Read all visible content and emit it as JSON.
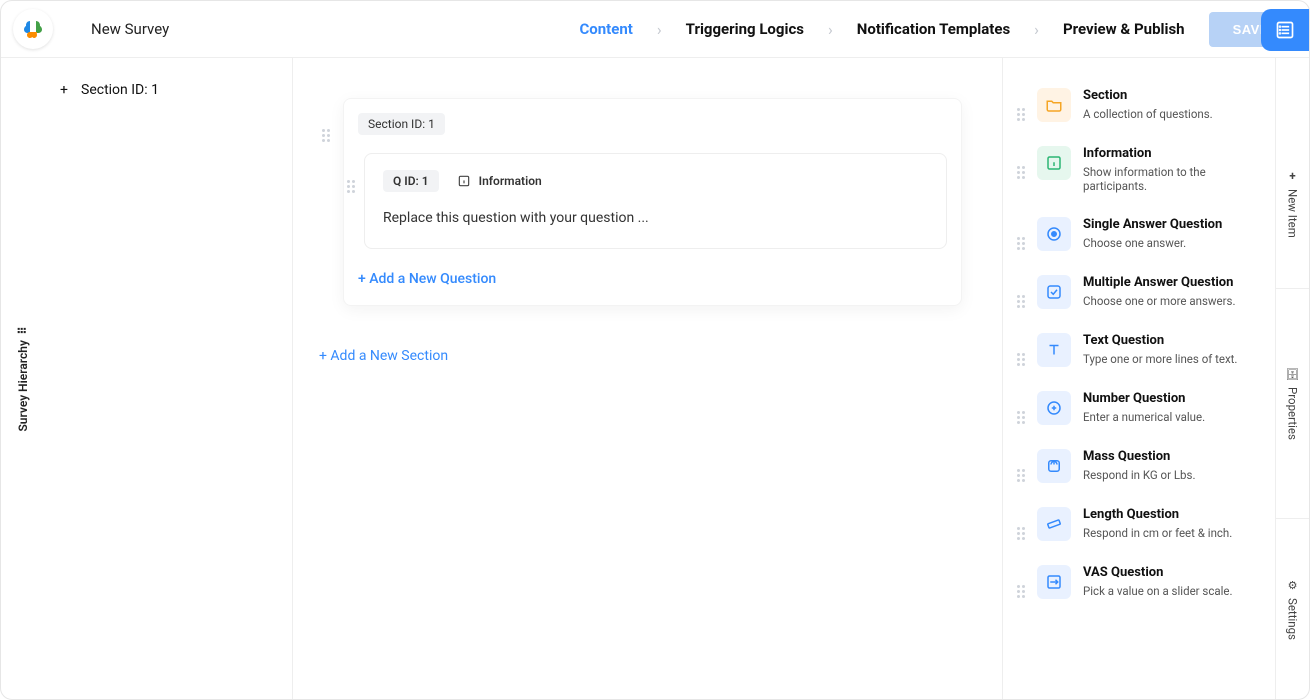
{
  "header": {
    "title": "New Survey",
    "breadcrumbs": [
      "Content",
      "Triggering Logics",
      "Notification Templates",
      "Preview & Publish"
    ],
    "active_breadcrumb": 0,
    "save_label": "SAVE"
  },
  "left_rail": {
    "label": "Survey Hierarchy"
  },
  "hierarchy": {
    "rows": [
      {
        "label": "Section ID: 1"
      }
    ]
  },
  "canvas": {
    "section_pill": "Section ID: 1",
    "question": {
      "id_pill": "Q ID: 1",
      "type_label": "Information",
      "body": "Replace this question with your question ..."
    },
    "add_question_label": "+ Add a New Question",
    "add_section_label": "+ Add a New Section"
  },
  "items_panel": [
    {
      "kind": "section",
      "name": "Section",
      "desc": "A collection of questions."
    },
    {
      "kind": "info",
      "name": "Information",
      "desc": "Show information to the participants."
    },
    {
      "kind": "blue",
      "name": "Single Answer Question",
      "desc": "Choose one answer."
    },
    {
      "kind": "blue",
      "name": "Multiple Answer Question",
      "desc": "Choose one or more answers."
    },
    {
      "kind": "blue",
      "name": "Text Question",
      "desc": "Type one or more lines of text."
    },
    {
      "kind": "blue",
      "name": "Number Question",
      "desc": "Enter a numerical value."
    },
    {
      "kind": "blue",
      "name": "Mass Question",
      "desc": "Respond in KG or Lbs."
    },
    {
      "kind": "blue",
      "name": "Length Question",
      "desc": "Respond in cm or feet & inch."
    },
    {
      "kind": "blue",
      "name": "VAS Question",
      "desc": "Pick a value on a slider scale."
    }
  ],
  "right_rail": {
    "tabs": [
      "New Item",
      "Properties",
      "Settings"
    ],
    "plus": "+"
  }
}
